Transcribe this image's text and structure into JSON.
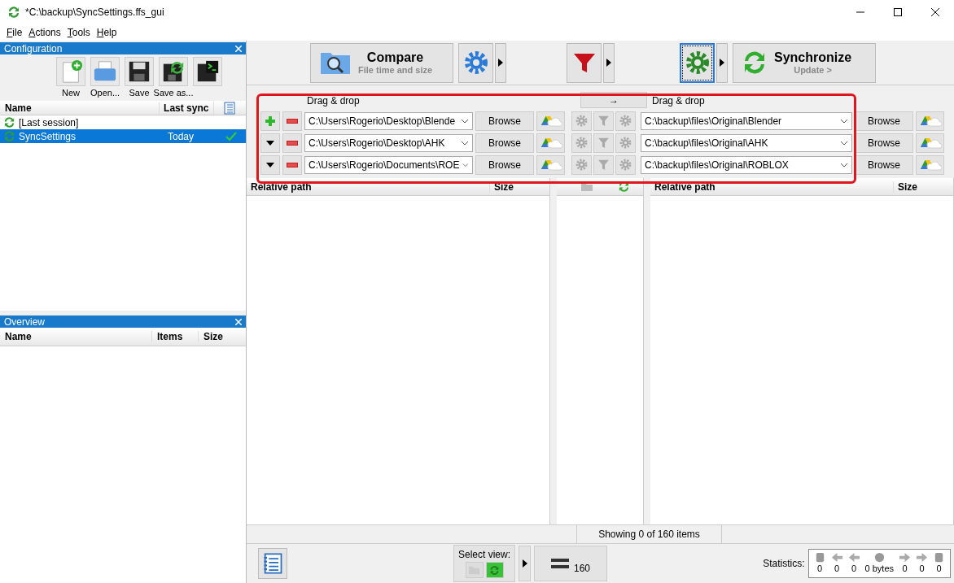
{
  "window": {
    "title": "*C:\\backup\\SyncSettings.ffs_gui"
  },
  "menu": [
    {
      "label": "File"
    },
    {
      "label": "Actions"
    },
    {
      "label": "Tools"
    },
    {
      "label": "Help"
    }
  ],
  "configuration": {
    "title": "Configuration",
    "tools": [
      {
        "kind": "new",
        "label": "New"
      },
      {
        "kind": "open",
        "label": "Open..."
      },
      {
        "kind": "save",
        "label": "Save"
      },
      {
        "kind": "saveas",
        "label": "Save as..."
      },
      {
        "kind": "batch"
      }
    ],
    "columns": [
      "Name",
      "Last sync"
    ],
    "rows": [
      {
        "name": "[Last session]",
        "synced": false,
        "selected": false
      },
      {
        "name": "SyncSettings",
        "last_sync": "Today",
        "synced": true,
        "selected": true
      }
    ]
  },
  "overview": {
    "title": "Overview",
    "columns": [
      "Name",
      "Items",
      "Size"
    ]
  },
  "toolbar": {
    "compare": {
      "label": "Compare",
      "sublabel": "File time and size"
    },
    "synchronize": {
      "label": "Synchronize",
      "sublabel": "Update >"
    }
  },
  "folder_pairs": {
    "left_header": "Drag & drop",
    "swap": "→",
    "right_header": "Drag & drop",
    "pairs": [
      {
        "kind": "add",
        "left": "C:\\Users\\Rogerio\\Desktop\\Blende",
        "left_browse": "Browse",
        "right": "C:\\backup\\files\\Original\\Blender",
        "right_browse": "Browse"
      },
      {
        "kind": "remove",
        "left": "C:\\Users\\Rogerio\\Desktop\\AHK",
        "left_browse": "Browse",
        "right": "C:\\backup\\files\\Original\\AHK",
        "right_browse": "Browse"
      },
      {
        "kind": "remove",
        "left": "C:\\Users\\Rogerio\\Documents\\ROE",
        "left_browse": "Browse",
        "right": "C:\\backup\\files\\Original\\ROBLOX",
        "right_browse": "Browse"
      }
    ]
  },
  "left_grid": {
    "columns": [
      "Relative path",
      "Size"
    ]
  },
  "right_grid": {
    "columns": [
      "Relative path",
      "Size"
    ]
  },
  "status": "Showing 0 of 160 items",
  "bottom": {
    "select_view": "Select view:",
    "count": "160",
    "statistics_label": "Statistics:",
    "stats": [
      "0",
      "0",
      "0",
      "0 bytes",
      "0",
      "0",
      "0"
    ]
  }
}
